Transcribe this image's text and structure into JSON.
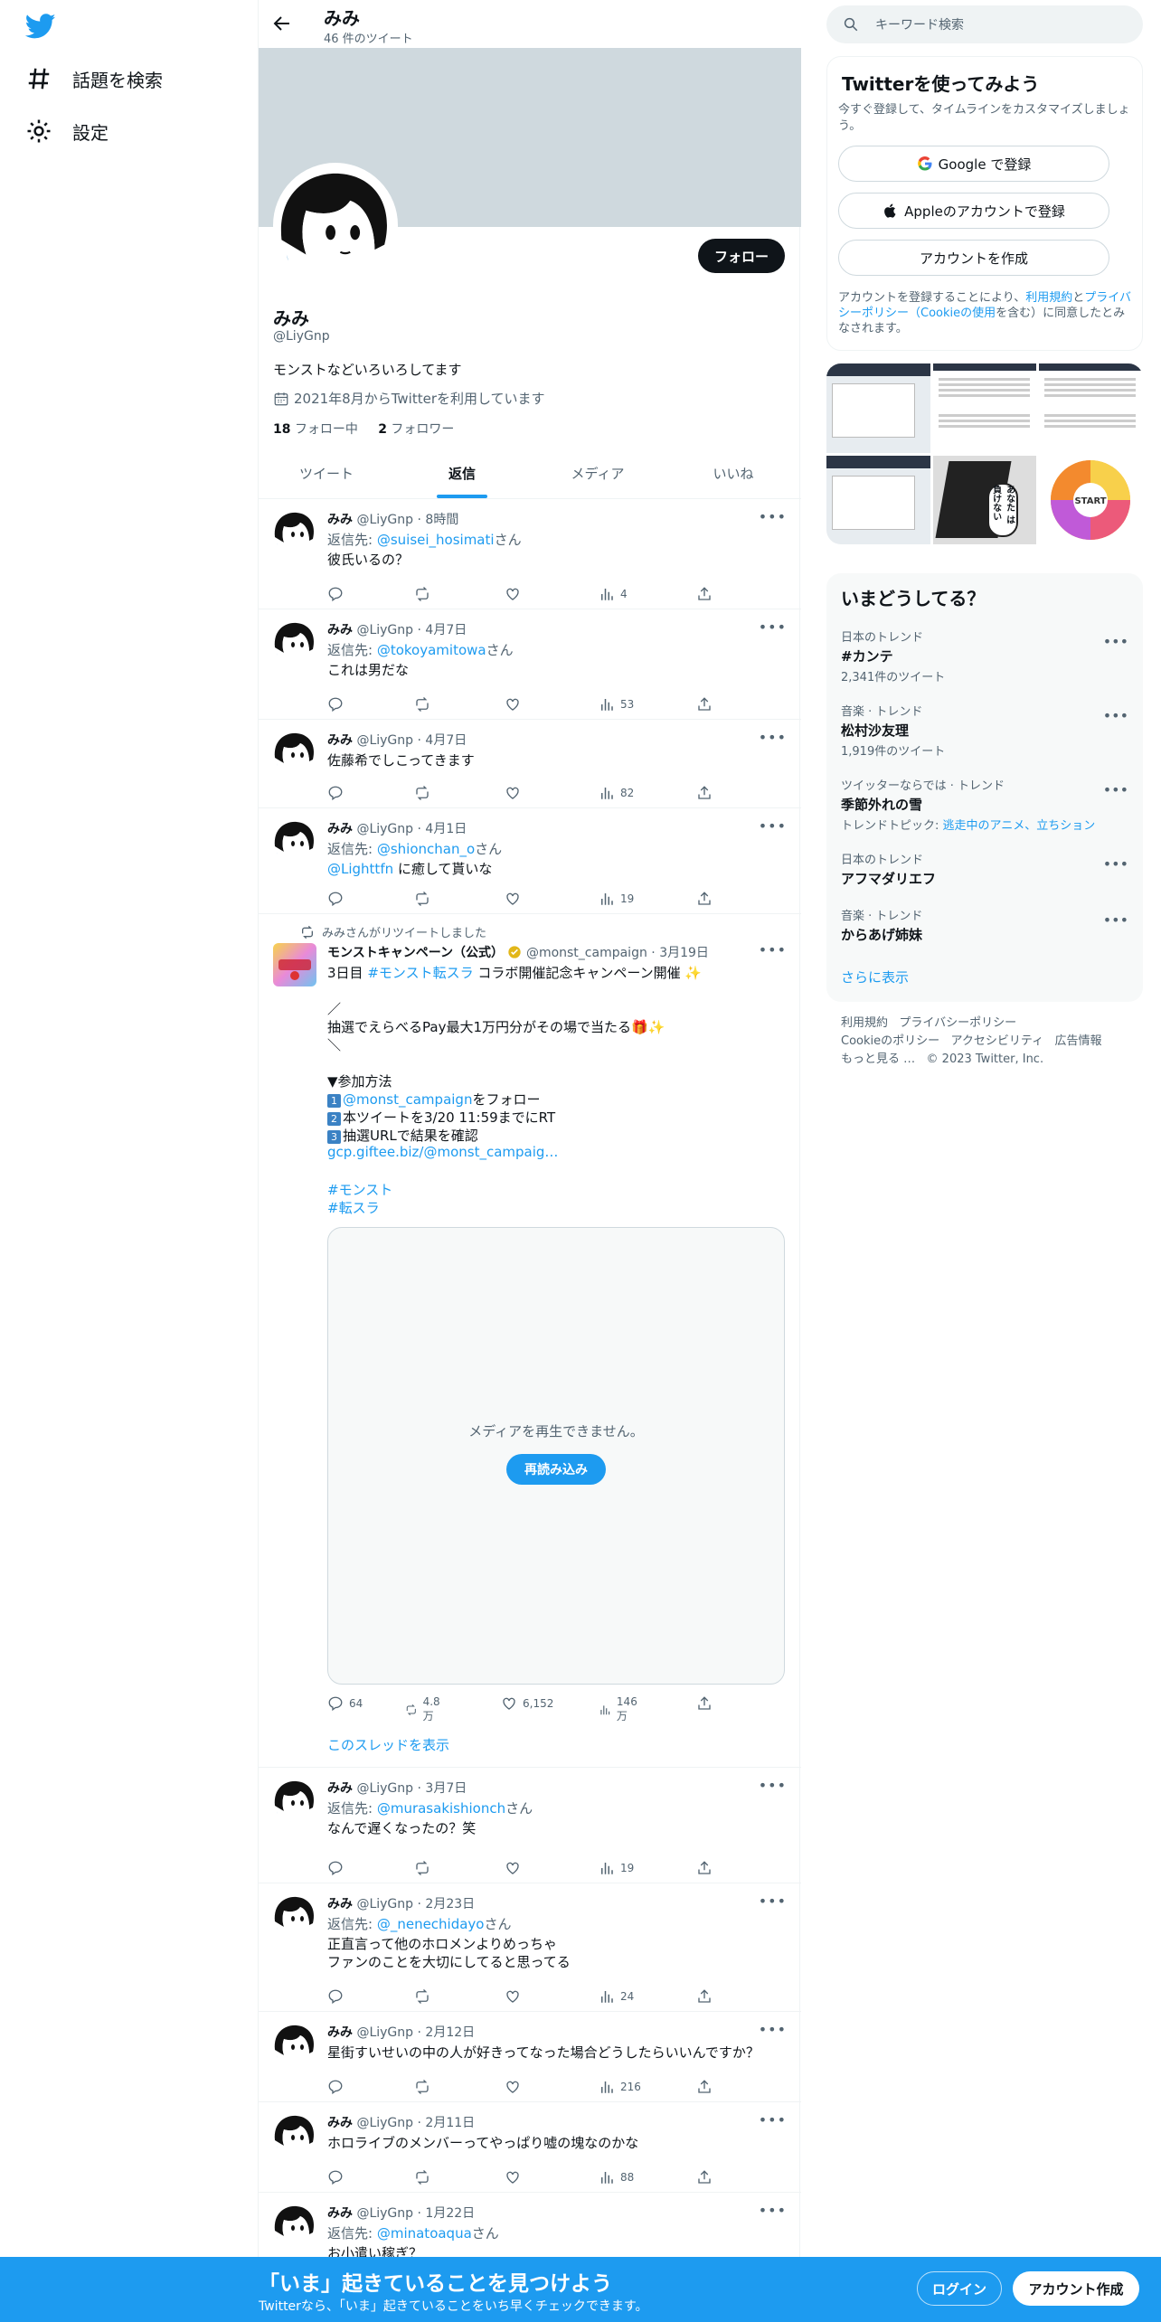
{
  "nav": {
    "items": [
      {
        "label": "話題を検索",
        "icon": "hashtag-icon"
      },
      {
        "label": "設定",
        "icon": "gear-icon"
      }
    ]
  },
  "header": {
    "name": "みみ",
    "tweet_count": "46 件のツイート"
  },
  "profile": {
    "name": "みみ",
    "handle": "@LiyGnp",
    "bio": "モンストなどいろいろしてます",
    "joined": "2021年8月からTwitterを利用しています",
    "following_count": "18",
    "following_label": "フォロー中",
    "followers_count": "2",
    "followers_label": "フォロワー",
    "follow_button": "フォロー"
  },
  "tabs": [
    {
      "label": "ツイート"
    },
    {
      "label": "返信"
    },
    {
      "label": "メディア"
    },
    {
      "label": "いいね"
    }
  ],
  "tweets": [
    {
      "name": "みみ",
      "handle": "@LiyGnp",
      "time": "8時間",
      "reply_prefix": "返信先: ",
      "reply_to": "@suisei_hosimati",
      "reply_suffix": "さん",
      "lines": [
        "彼氏いるの？"
      ],
      "views": "4"
    },
    {
      "name": "みみ",
      "handle": "@LiyGnp",
      "time": "4月7日",
      "reply_prefix": "返信先: ",
      "reply_to": "@tokoyamitowa",
      "reply_suffix": "さん",
      "lines": [
        "これは男だな"
      ],
      "views": "53"
    },
    {
      "name": "みみ",
      "handle": "@LiyGnp",
      "time": "4月7日",
      "lines": [
        "佐藤希でしこってきます"
      ],
      "views": "82"
    },
    {
      "name": "みみ",
      "handle": "@LiyGnp",
      "time": "4月1日",
      "reply_prefix": "返信先: ",
      "reply_to": "@shionchan_o",
      "reply_suffix": "さん",
      "mention": "@Lighttfn",
      "lines": [
        " に癒して貰いな"
      ],
      "views": "19"
    }
  ],
  "retweet": {
    "rt_label": "みみさんがリツイートしました",
    "name": "モンストキャンペーン（公式）",
    "handle": "@monst_campaign",
    "time": "3月19日",
    "line1_a": "3日目 ",
    "line1_tag": "#モンスト転スラ",
    "line1_b": " コラボ開催記念キャンペーン開催 ✨",
    "slash1": "／",
    "line2": "抽選でえらべるPay最大1万円分がその場で当たる🎁✨",
    "slash2": "＼",
    "howto": "▼参加方法",
    "step1_num": "1",
    "step1_link": "@monst_campaign",
    "step1_text": "をフォロー",
    "step2_num": "2",
    "step2_text": "本ツイートを3/20 11:59までにRT",
    "step3_num": "3",
    "step3_text": "抽選URLで結果を確認",
    "url": "gcp.giftee.biz/@monst_campaig…",
    "tag1": "#モンスト",
    "tag2": "#転スラ",
    "media_msg": "メディアを再生できません。",
    "reload": "再読み込み",
    "replies": "64",
    "retweets": "4.8万",
    "likes": "6,152",
    "views": "146万",
    "thread": "このスレッドを表示"
  },
  "tweets2": [
    {
      "name": "みみ",
      "handle": "@LiyGnp",
      "time": "3月7日",
      "reply_prefix": "返信先: ",
      "reply_to": "@murasakishionch",
      "reply_suffix": "さん",
      "lines": [
        "なんで遅くなったの？笑"
      ],
      "views": "19"
    },
    {
      "name": "みみ",
      "handle": "@LiyGnp",
      "time": "2月23日",
      "reply_prefix": "返信先: ",
      "reply_to": "@_nenechidayo",
      "reply_suffix": "さん",
      "lines": [
        "正直言って他のホロメンよりめっちゃ",
        "ファンのことを大切にしてると思ってる"
      ],
      "views": "24"
    },
    {
      "name": "みみ",
      "handle": "@LiyGnp",
      "time": "2月12日",
      "lines": [
        "星街すいせいの中の人が好きってなった場合どうしたらいいんですか？"
      ],
      "views": "216"
    },
    {
      "name": "みみ",
      "handle": "@LiyGnp",
      "time": "2月11日",
      "lines": [
        "ホロライブのメンバーってやっぱり嘘の塊なのかな"
      ],
      "views": "88"
    },
    {
      "name": "みみ",
      "handle": "@LiyGnp",
      "time": "1月22日",
      "reply_prefix": "返信先: ",
      "reply_to": "@minatoaqua",
      "reply_suffix": "さん",
      "lines": [
        "お小遣い稼ぎ？"
      ],
      "views": ""
    }
  ],
  "search": {
    "placeholder": "キーワード検索"
  },
  "signup_card": {
    "title": "Twitterを使ってみよう",
    "subtitle": "今すぐ登録して、タイムラインをカスタマイズしましょう。",
    "google": "Google で登録",
    "apple": "Appleのアカウントで登録",
    "create": "アカウントを作成",
    "legal_a": "アカウントを登録することにより、",
    "legal_terms": "利用規約",
    "legal_b": "と",
    "legal_privacy": "プライバシーポリシー（Cookieの使用",
    "legal_c": "を含む）に同意したとみなされます。"
  },
  "photos": {
    "start_label": "START",
    "manga_text": "あなた\nは\n負けない"
  },
  "trends": {
    "title": "いまどうしてる？",
    "items": [
      {
        "context": "日本のトレンド",
        "name": "#カンテ",
        "count": "2,341件のツイート"
      },
      {
        "context": "音楽 · トレンド",
        "name": "松村沙友理",
        "count": "1,919件のツイート"
      },
      {
        "context": "ツイッターならでは · トレンド",
        "name": "季節外れの雪",
        "topic_prefix": "トレンドトピック: ",
        "topic": "逃走中のアニメ、立ちション"
      },
      {
        "context": "日本のトレンド",
        "name": "アフマダリエフ"
      },
      {
        "context": "音楽 · トレンド",
        "name": "からあげ姉妹"
      }
    ],
    "show_more": "さらに表示"
  },
  "footer": {
    "links": [
      "利用規約",
      "プライバシーポリシー",
      "Cookieのポリシー",
      "アクセシビリティ",
      "広告情報",
      "もっと見る …"
    ],
    "copyright": "© 2023 Twitter, Inc."
  },
  "bottom_bar": {
    "title": "「いま」起きていることを見つけよう",
    "subtitle": "Twitterなら、「いま」起きていることをいち早くチェックできます。",
    "login": "ログイン",
    "signup": "アカウント作成"
  },
  "colors": {
    "accent": "#1d9bf0",
    "text": "#0f1419",
    "muted": "#536471",
    "banner": "#cfd9de"
  }
}
